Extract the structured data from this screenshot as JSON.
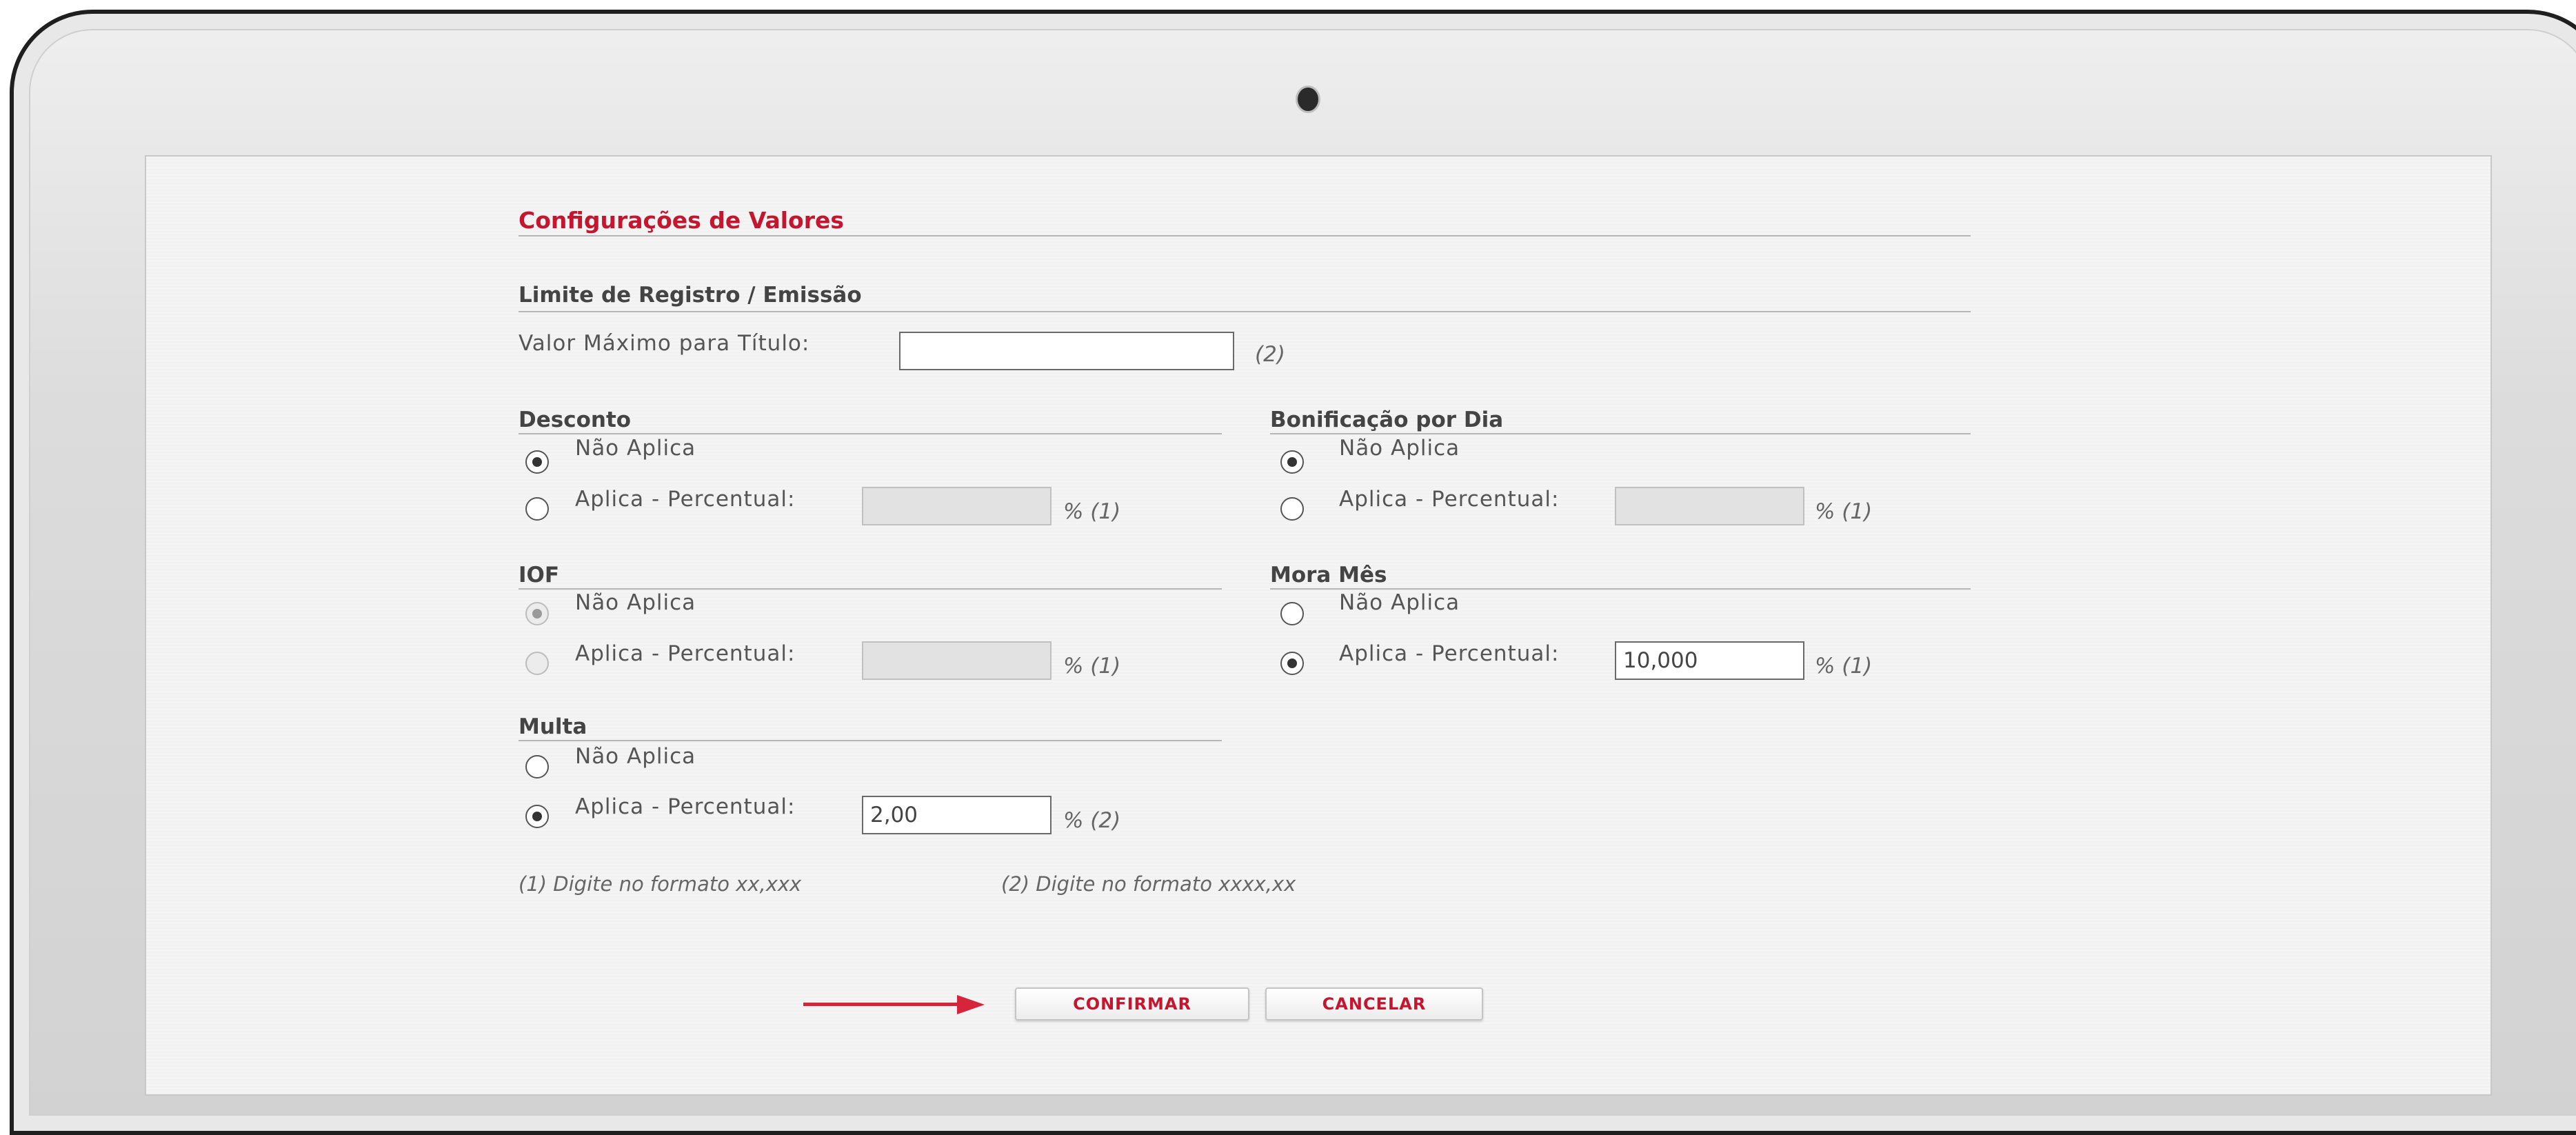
{
  "page": {
    "title": "Configurações de Valores"
  },
  "limite": {
    "heading": "Limite de Registro / Emissão",
    "label": "Valor Máximo para Título:",
    "value": "",
    "note_ref": "(2)"
  },
  "desconto": {
    "heading": "Desconto",
    "option_nao": "Não Aplica",
    "option_aplica": "Aplica - Percentual:",
    "selected": "nao",
    "value": "",
    "unit": "% (1)",
    "disabled_field": true
  },
  "bonificacao": {
    "heading": "Bonificação por Dia",
    "option_nao": "Não Aplica",
    "option_aplica": "Aplica - Percentual:",
    "selected": "nao",
    "value": "",
    "unit": "% (1)",
    "disabled_field": true
  },
  "iof": {
    "heading": "IOF",
    "option_nao": "Não Aplica",
    "option_aplica": "Aplica - Percentual:",
    "selected": "nao",
    "disabled": true,
    "value": "",
    "unit": "% (1)"
  },
  "mora": {
    "heading": "Mora Mês",
    "option_nao": "Não Aplica",
    "option_aplica": "Aplica - Percentual:",
    "selected": "aplica",
    "value": "10,000",
    "unit": "% (1)"
  },
  "multa": {
    "heading": "Multa",
    "option_nao": "Não Aplica",
    "option_aplica": "Aplica - Percentual:",
    "selected": "aplica",
    "value": "2,00",
    "unit": "% (2)"
  },
  "notes": {
    "note1": "(1) Digite no formato xx,xxx",
    "note2": "(2) Digite no formato xxxx,xx"
  },
  "buttons": {
    "confirm": "CONFIRMAR",
    "cancel": "CANCELAR"
  },
  "colors": {
    "accent": "#c4162e",
    "arrow": "#d6243c"
  }
}
